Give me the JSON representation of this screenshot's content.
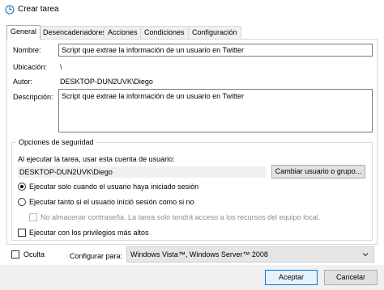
{
  "window": {
    "title": "Crear tarea",
    "icon": "task-scheduler-clock-icon"
  },
  "tabs": [
    {
      "label": "General",
      "active": true
    },
    {
      "label": "Desencadenadores",
      "active": false
    },
    {
      "label": "Acciones",
      "active": false
    },
    {
      "label": "Condiciones",
      "active": false
    },
    {
      "label": "Configuración",
      "active": false
    }
  ],
  "general": {
    "name_label": "Nombre:",
    "name_value": "Script que extrae la información de un usuario en Twitter",
    "location_label": "Ubicación:",
    "location_value": "\\",
    "author_label": "Autor:",
    "author_value": "DESKTOP-DUN2UVK\\Diego",
    "description_label": "Descripción:",
    "description_value": "Script que extrae la información de un usuario en Twitter"
  },
  "security": {
    "group_title": "Opciones de seguridad",
    "run_as_label": "Al ejecutar la tarea, usar esta cuenta de usuario:",
    "user_value": "DESKTOP-DUN2UVK\\Diego",
    "change_user_button": "Cambiar usuario o grupo...",
    "radio_logged_on": "Ejecutar solo cuando el usuario haya iniciado sesión",
    "radio_logged_on_selected": true,
    "radio_whether": "Ejecutar tanto si el usuario inició sesión como si no",
    "radio_whether_selected": false,
    "no_store_password": "No almacenar contraseña. La tarea solo tendrá acceso a los recursos del equipo local.",
    "no_store_password_checked": false,
    "highest_privileges": "Ejecutar con los privilegios más altos",
    "highest_privileges_checked": false
  },
  "footer": {
    "hidden_label": "Oculta",
    "hidden_checked": false,
    "configure_label": "Configurar para:",
    "configure_value": "Windows Vista™, Windows Server™ 2008",
    "accept_button": "Aceptar",
    "cancel_button": "Cancelar"
  },
  "colors": {
    "accent": "#0078d7",
    "button_bg": "#e1e1e1",
    "dialog_bg": "#f0f0f0"
  }
}
